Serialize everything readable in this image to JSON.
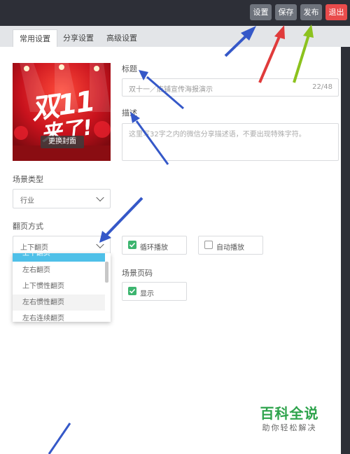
{
  "toolbar": {
    "settings_label": "设置",
    "save_label": "保存",
    "publish_label": "发布",
    "exit_label": "退出",
    "colors": {
      "neutral": "#6e737c",
      "exit": "#e94b4b"
    }
  },
  "tabs": [
    {
      "label": "常用设置",
      "active": true
    },
    {
      "label": "分享设置",
      "active": false
    },
    {
      "label": "高级设置",
      "active": false
    }
  ],
  "cover": {
    "poster_text_line1": "双11",
    "poster_text_line2": "来了!",
    "change_button": "更换封面"
  },
  "title_field": {
    "label": "标题",
    "value": "双十一／店铺宣传海报演示",
    "counter": "22/48"
  },
  "description_field": {
    "label": "描述",
    "placeholder": "这里写32字之内的微信分享描述语，不要出现特殊字符。"
  },
  "scene_type": {
    "label": "场景类型",
    "selected": "行业"
  },
  "page_flip": {
    "label": "翻页方式",
    "selected": "上下翻页",
    "options": [
      "上下翻页",
      "左右翻页",
      "上下惯性翻页",
      "左右惯性翻页",
      "左右连续翻页"
    ]
  },
  "loop_play": {
    "label": "循环播放",
    "checked": true
  },
  "auto_play": {
    "label": "自动播放",
    "checked": false
  },
  "scene_page_number": {
    "label": "场景页码",
    "option_label": "显示",
    "checked": true
  },
  "watermark": {
    "title": "百科全说",
    "subtitle": "助你轻松解决"
  },
  "annotation_colors": {
    "blue": "#3558c8",
    "red": "#e03b3b",
    "green": "#8cc21e"
  }
}
